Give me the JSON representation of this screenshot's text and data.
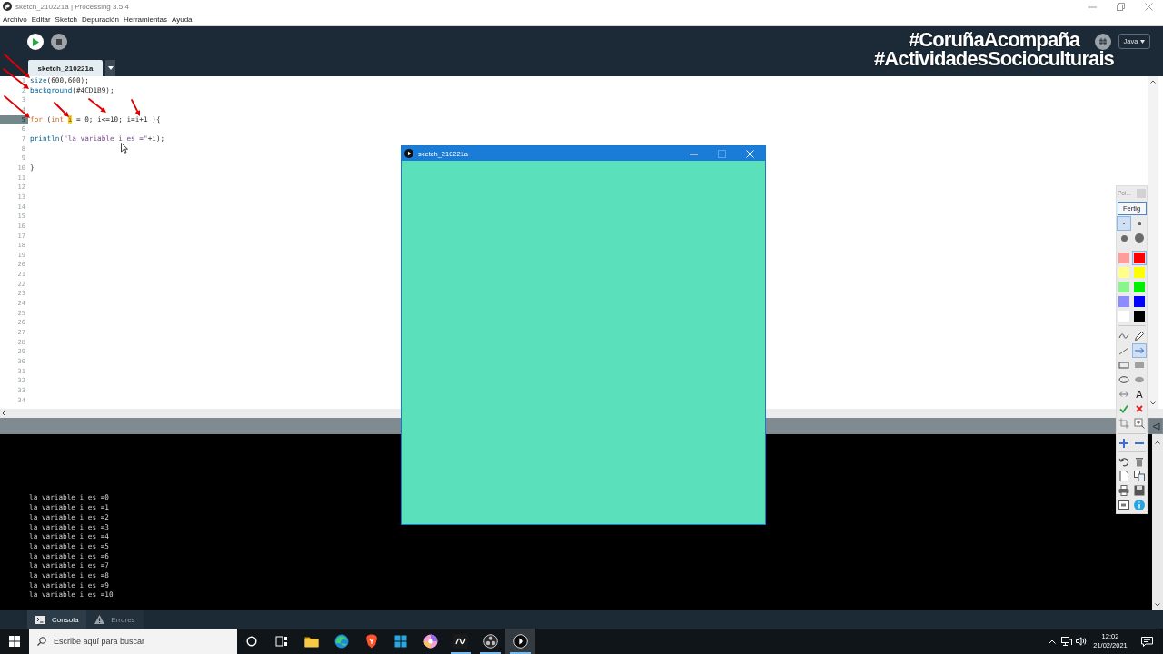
{
  "window": {
    "title": "sketch_210221a | Processing 3.5.4"
  },
  "menu": [
    "Archivo",
    "Editar",
    "Sketch",
    "Depuración",
    "Herramientas",
    "Ayuda"
  ],
  "overlay_caption": [
    "#CoruñaAcompaña",
    "#ActividadesSocioculturais"
  ],
  "mode": "Java",
  "tabs": [
    {
      "label": "sketch_210221a",
      "selected": true
    }
  ],
  "editor": {
    "lines": [
      {
        "number": "1",
        "current": false,
        "tokens": [
          {
            "kind": "function",
            "text": "size"
          },
          {
            "kind": "plain",
            "text": "(600,600);"
          }
        ]
      },
      {
        "number": "2",
        "current": false,
        "tokens": [
          {
            "kind": "function",
            "text": "background"
          },
          {
            "kind": "plain",
            "text": "(#4CD1B9);"
          }
        ]
      },
      {
        "number": "3",
        "current": false
      },
      {
        "number": "4",
        "current": false
      },
      {
        "number": "5",
        "current": true,
        "tokens": [
          {
            "kind": "keyword",
            "text": "for"
          },
          {
            "kind": "plain",
            "text": " ("
          },
          {
            "kind": "keyword",
            "text": "int "
          },
          {
            "kind": "highlight",
            "text": "i"
          },
          {
            "kind": "plain",
            "text": " = 0; i<=10; i=i+1 ){"
          }
        ]
      },
      {
        "number": "6",
        "current": false
      },
      {
        "number": "7",
        "current": false,
        "tokens": [
          {
            "kind": "function",
            "text": "println"
          },
          {
            "kind": "plain",
            "text": "("
          },
          {
            "kind": "string",
            "text": "\"la variable i es =\""
          },
          {
            "kind": "plain",
            "text": "+i);"
          }
        ]
      },
      {
        "number": "8",
        "current": false
      },
      {
        "number": "9",
        "current": false
      },
      {
        "number": "10",
        "current": false,
        "tokens": [
          {
            "kind": "plain",
            "text": "}"
          }
        ]
      },
      {
        "number": "11",
        "current": false
      },
      {
        "number": "12",
        "current": false
      },
      {
        "number": "13",
        "current": false
      },
      {
        "number": "14",
        "current": false
      },
      {
        "number": "15",
        "current": false
      },
      {
        "number": "16",
        "current": false
      },
      {
        "number": "17",
        "current": false
      },
      {
        "number": "18",
        "current": false
      },
      {
        "number": "19",
        "current": false
      },
      {
        "number": "20",
        "current": false
      },
      {
        "number": "21",
        "current": false
      },
      {
        "number": "22",
        "current": false
      },
      {
        "number": "23",
        "current": false
      },
      {
        "number": "24",
        "current": false
      },
      {
        "number": "25",
        "current": false
      },
      {
        "number": "26",
        "current": false
      },
      {
        "number": "27",
        "current": false
      },
      {
        "number": "28",
        "current": false
      },
      {
        "number": "29",
        "current": false
      },
      {
        "number": "30",
        "current": false
      },
      {
        "number": "31",
        "current": false
      },
      {
        "number": "32",
        "current": false
      },
      {
        "number": "33",
        "current": false
      },
      {
        "number": "34",
        "current": false
      }
    ]
  },
  "console": {
    "lines": [
      "la variable i es =0",
      "la variable i es =1",
      "la variable i es =2",
      "la variable i es =3",
      "la variable i es =4",
      "la variable i es =5",
      "la variable i es =6",
      "la variable i es =7",
      "la variable i es =8",
      "la variable i es =9",
      "la variable i es =10"
    ]
  },
  "console_tabs": [
    {
      "kind": "console",
      "label": "Consola",
      "selected": true
    },
    {
      "kind": "errors",
      "label": "Errores",
      "selected": false
    }
  ],
  "sketch_window": {
    "title": "sketch_210221a",
    "controls": [
      {
        "kind": "minimize",
        "disabled": false
      },
      {
        "kind": "maximize",
        "disabled": true
      },
      {
        "kind": "close",
        "disabled": false
      }
    ]
  },
  "annotation_palette": {
    "title": "Poi...",
    "done_button": "Fertig",
    "pen_sizes": [
      {
        "selected": true
      },
      {
        "selected": false
      },
      {
        "selected": false
      },
      {
        "selected": false
      }
    ],
    "colors": [
      {
        "color": "#ff9c9c",
        "selected": false
      },
      {
        "color": "#ff0000",
        "selected": true
      },
      {
        "color": "#ffff8a",
        "selected": false
      },
      {
        "color": "#ffff00",
        "selected": false
      },
      {
        "color": "#8af58a",
        "selected": false
      },
      {
        "color": "#00ee00",
        "selected": false
      },
      {
        "color": "#8c8cff",
        "selected": false
      },
      {
        "color": "#0000ff",
        "selected": false
      },
      {
        "color": "#ffffff",
        "selected": false
      },
      {
        "color": "#000000",
        "selected": false
      }
    ],
    "draw_tools": [
      {
        "kind": "freehand",
        "selected": false
      },
      {
        "kind": "pencil",
        "selected": false
      },
      {
        "kind": "line",
        "selected": false
      },
      {
        "kind": "arrow",
        "selected": true
      },
      {
        "kind": "rectangle",
        "selected": false
      },
      {
        "kind": "filled_rectangle",
        "selected": false
      },
      {
        "kind": "ellipse",
        "selected": false
      },
      {
        "kind": "filled_ellipse",
        "selected": false
      },
      {
        "kind": "double_arrow",
        "selected": false
      },
      {
        "kind": "text",
        "label": "A",
        "selected": false
      }
    ],
    "action_groups": [
      [
        {
          "kind": "check"
        },
        {
          "kind": "cross"
        },
        {
          "kind": "crop"
        },
        {
          "kind": "zoom"
        }
      ],
      [
        {
          "kind": "plus"
        },
        {
          "kind": "minus"
        }
      ],
      [
        {
          "kind": "undo"
        },
        {
          "kind": "trash"
        },
        {
          "kind": "page"
        },
        {
          "kind": "copy"
        },
        {
          "kind": "print"
        },
        {
          "kind": "save"
        },
        {
          "kind": "screen"
        },
        {
          "kind": "info"
        }
      ]
    ]
  },
  "taskbar": {
    "search": {
      "placeholder": "Escribe aquí para buscar"
    },
    "apps": [
      {
        "kind": "ring",
        "running": false,
        "active": false
      },
      {
        "kind": "task_view",
        "running": false,
        "active": false
      },
      {
        "kind": "folder",
        "running": false,
        "active": false
      },
      {
        "kind": "swirl",
        "running": false,
        "active": false
      },
      {
        "kind": "shield",
        "running": false,
        "active": false
      },
      {
        "kind": "tiles",
        "running": false,
        "active": false
      },
      {
        "kind": "color_wheel",
        "running": false,
        "active": false
      },
      {
        "kind": "app",
        "running": true,
        "active": false
      },
      {
        "kind": "aperture",
        "running": true,
        "active": false
      },
      {
        "kind": "play",
        "running": true,
        "active": true
      }
    ],
    "time": "12:02",
    "date": "21/02/2021"
  }
}
